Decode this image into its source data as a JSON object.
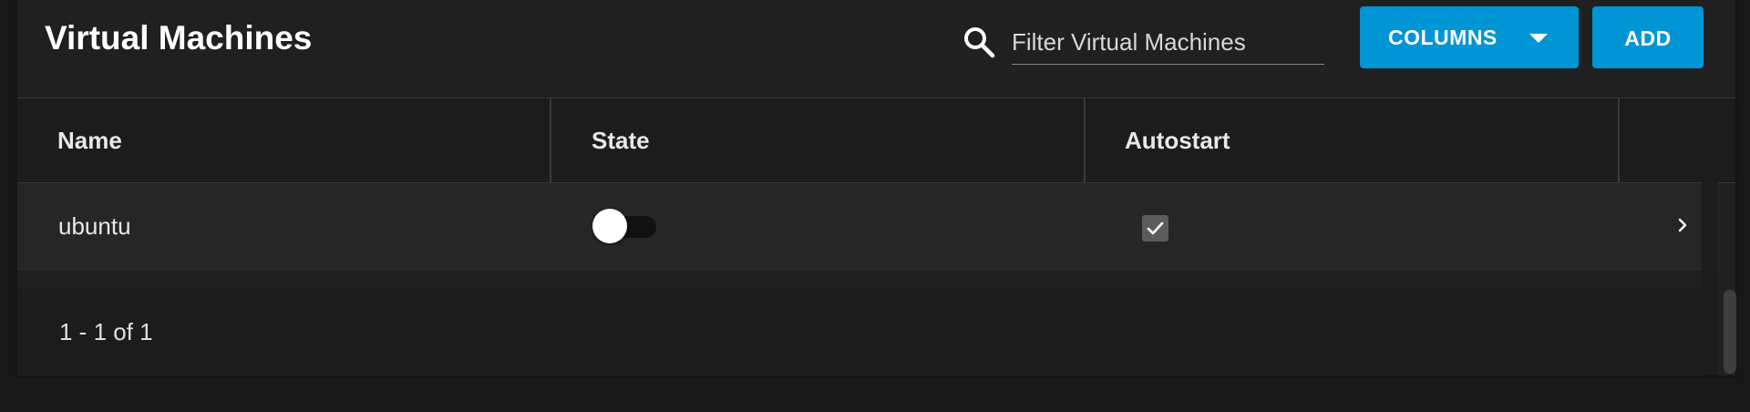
{
  "header": {
    "title": "Virtual Machines",
    "search_icon": "search-icon",
    "search_placeholder": "Filter Virtual Machines",
    "search_value": "",
    "columns_button_label": "COLUMNS",
    "columns_button_icon": "caret-down-icon",
    "add_button_label": "ADD"
  },
  "colors": {
    "accent": "#0095d5",
    "background": "#181818",
    "card": "#202020"
  },
  "table": {
    "columns": [
      "Name",
      "State",
      "Autostart",
      ""
    ],
    "rows": [
      {
        "name": "ubuntu",
        "state_on": false,
        "autostart": true,
        "expand_icon": "chevron-right-icon"
      }
    ]
  },
  "paginator": {
    "range_label": "1 - 1 of 1"
  }
}
